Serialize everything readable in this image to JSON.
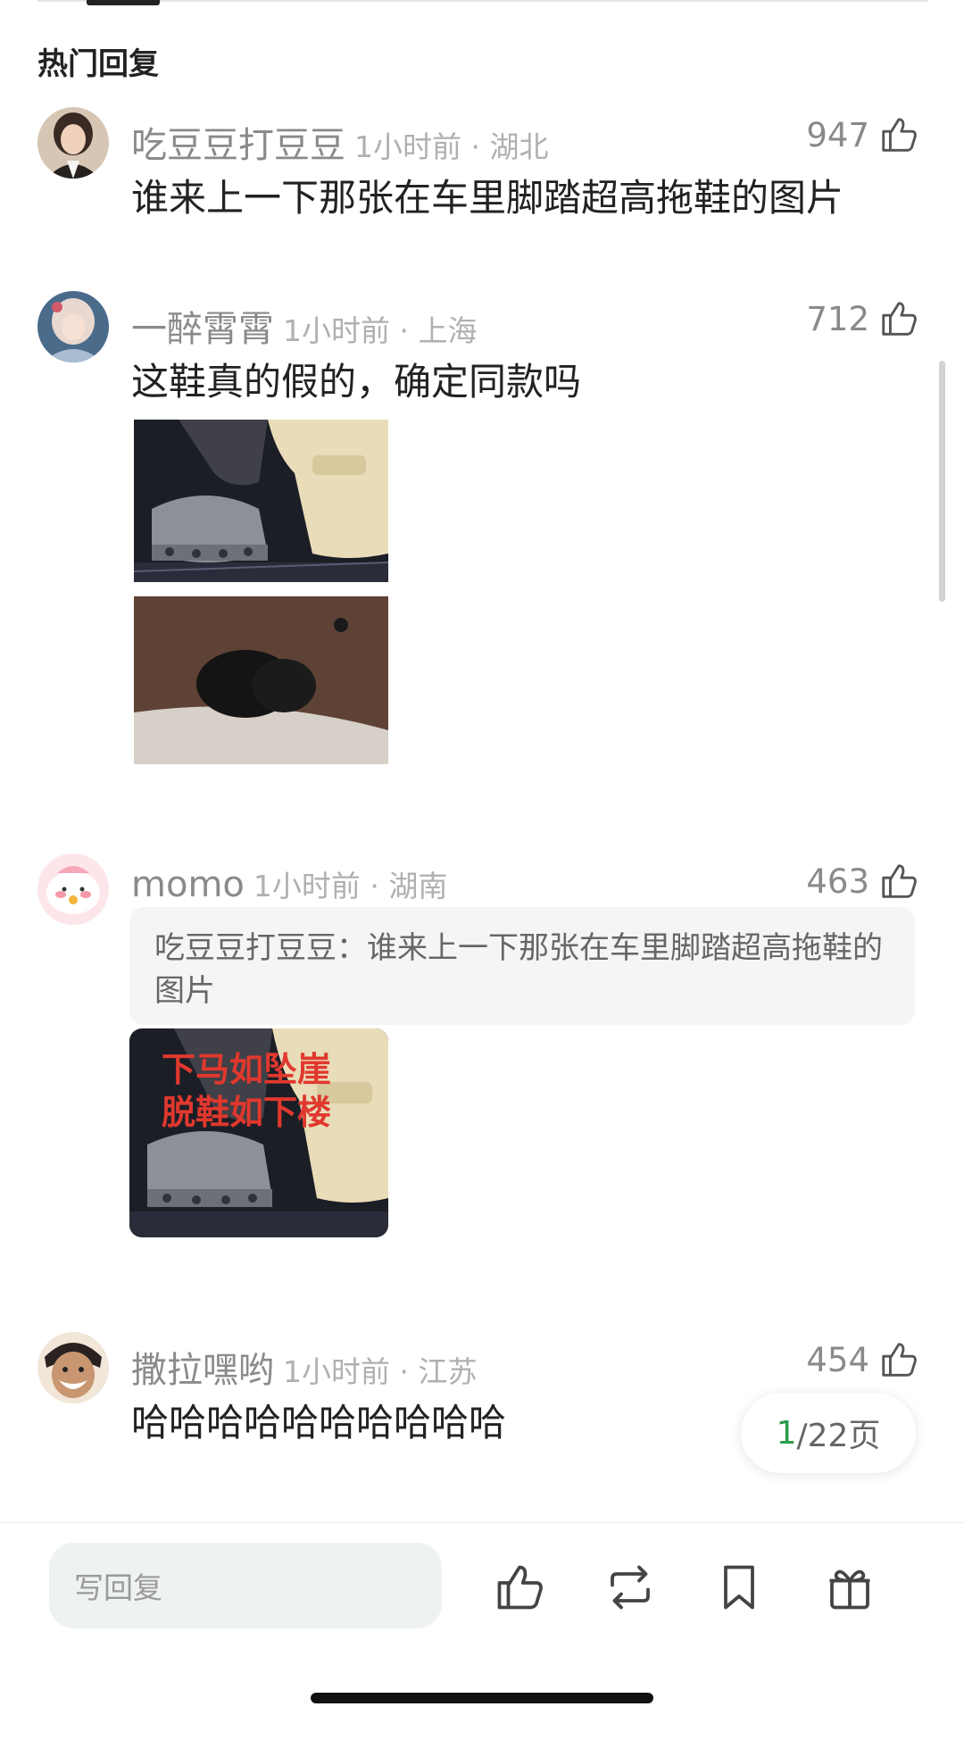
{
  "section_title": "热门回复",
  "comments": [
    {
      "username": "吃豆豆打豆豆",
      "meta": "1小时前 · 湖北",
      "likes": "947",
      "content": "谁来上一下那张在车里脚踏超高拖鞋的图片"
    },
    {
      "username": "一醉霄霄",
      "meta": "1小时前 · 上海",
      "likes": "712",
      "content": "这鞋真的假的，确定同款吗"
    },
    {
      "username": "momo",
      "meta": "1小时前 · 湖南",
      "likes": "463",
      "quote": "吃豆豆打豆豆：谁来上一下那张在车里脚踏超高拖鞋的图片",
      "image_caption_line1": "下马如坠崖",
      "image_caption_line2": "脱鞋如下楼"
    },
    {
      "username": "撒拉嘿哟",
      "meta": "1小时前 · 江苏",
      "likes": "454",
      "content": "哈哈哈哈哈哈哈哈哈哈"
    }
  ],
  "pagination": {
    "current": "1",
    "rest": "/22页"
  },
  "bottom_bar": {
    "reply_placeholder": "写回复",
    "icons": [
      "like-icon",
      "repost-icon",
      "bookmark-icon",
      "gift-icon"
    ]
  }
}
